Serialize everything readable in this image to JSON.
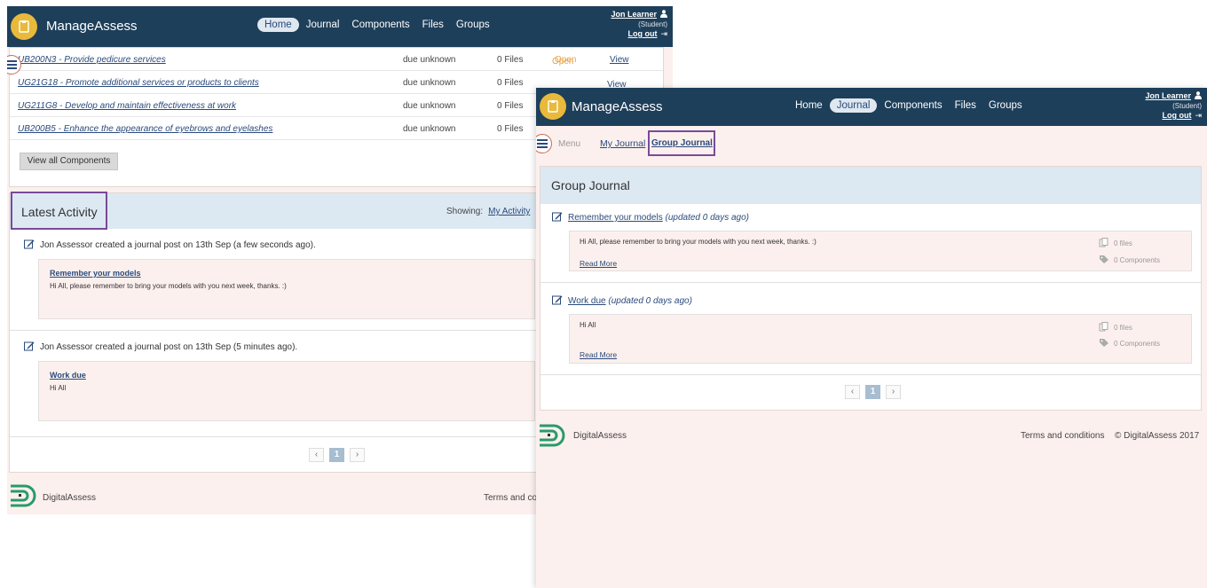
{
  "colors": {
    "topbar": "#1e3f5a",
    "accent": "#2a4a7b",
    "open_status": "#e6a34a",
    "highlight_box": "#7a4a9a",
    "logo": "#e8b93b",
    "footer_logo": "#2a9a6a"
  },
  "app": {
    "brand": "ManageAssess"
  },
  "user": {
    "name": "Jon Learner",
    "role": "(Student)",
    "logout": "Log out"
  },
  "nav": {
    "home": "Home",
    "journal": "Journal",
    "components": "Components",
    "files": "Files",
    "groups": "Groups"
  },
  "components": {
    "rows": [
      {
        "name": "UB200N3 - Provide pedicure services",
        "due": "due unknown",
        "files": "0 Files",
        "status": "Open",
        "view": "View"
      },
      {
        "name": "UG21G18 - Promote additional services or products to clients",
        "due": "due unknown",
        "files": "0 Files"
      },
      {
        "name": "UG211G8 - Develop and maintain effectiveness at work",
        "due": "due unknown",
        "files": "0 Files"
      },
      {
        "name": "UB200B5 - Enhance the appearance of eyebrows and eyelashes",
        "due": "due unknown",
        "files": "0 Files"
      }
    ],
    "view_all": "View all Components"
  },
  "win2_peek": {
    "status": "Open",
    "view": "View"
  },
  "activity": {
    "title": "Latest Activity",
    "showing_label": "Showing:",
    "showing_value": "My Activity",
    "items": [
      {
        "line": "Jon Assessor created a journal post on 13th Sep (a few seconds ago).",
        "post_title": "Remember your models",
        "post_body": "Hi All, please remember to bring your models with you next week, thanks. :)"
      },
      {
        "line": "Jon Assessor created a journal post on 13th Sep (5 minutes ago).",
        "post_title": "Work due",
        "post_body": "Hi All"
      }
    ]
  },
  "pager": {
    "prev": "‹",
    "current": "1",
    "next": "›"
  },
  "footer": {
    "brand": "DigitalAssess",
    "terms_cut": "Terms and co",
    "terms": "Terms and conditions",
    "copyright": "© DigitalAssess 2017"
  },
  "journal": {
    "menu_label": "Menu",
    "tab_my": "My Journal",
    "tab_group": "Group Journal",
    "panel_title": "Group Journal",
    "entries": [
      {
        "title": "Remember your models",
        "updated": "(updated 0 days ago)",
        "body": "Hi All, please remember to bring your models with you next week, thanks. :)",
        "read_more": "Read More",
        "files": "0 files",
        "components": "0 Components"
      },
      {
        "title": "Work due",
        "updated": "(updated 0 days ago)",
        "body": "Hi All",
        "read_more": "Read More",
        "files": "0 files",
        "components": "0 Components"
      }
    ]
  }
}
